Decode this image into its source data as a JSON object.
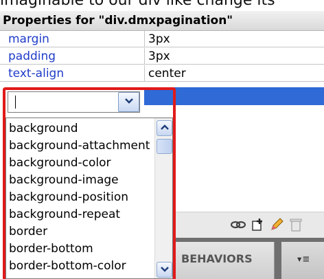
{
  "caption": "imaginable to our div like change its",
  "panel": {
    "title": "Properties for \"div.dmxpagination\""
  },
  "properties": [
    {
      "name": "margin",
      "value": "3px"
    },
    {
      "name": "padding",
      "value": "3px"
    },
    {
      "name": "text-align",
      "value": "center"
    }
  ],
  "new_property": {
    "input_value": "",
    "dropdown_icon": "chevron-down-icon"
  },
  "dropdown_options": [
    "background",
    "background-attachment",
    "background-color",
    "background-image",
    "background-position",
    "background-repeat",
    "border",
    "border-bottom",
    "border-bottom-color"
  ],
  "toolbar": {
    "icons": [
      "attach-css-icon",
      "new-css-rule-icon",
      "edit-rule-icon",
      "delete-icon"
    ]
  },
  "tabs": {
    "behaviors_label": "BEHAVIORS",
    "menu_symbol": "▾≡"
  },
  "colors": {
    "highlight": "#e11a1a",
    "selection": "#2f6ad6",
    "property_name": "#1f3cc9"
  }
}
